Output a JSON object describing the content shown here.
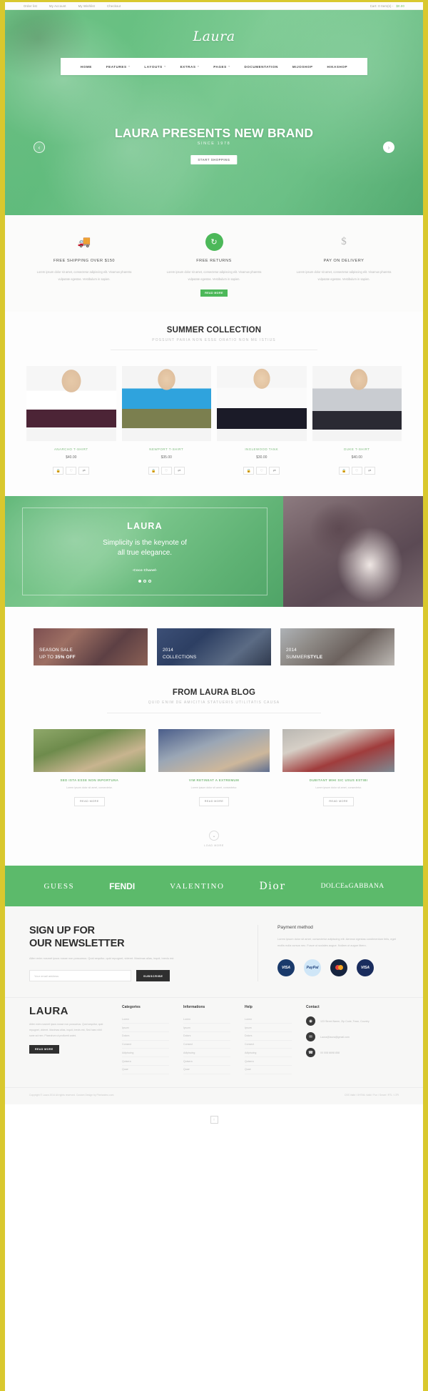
{
  "topbar": {
    "links": [
      "Order list",
      "My Account",
      "My Wishlist",
      "Checkout"
    ],
    "cart_label": "Cart: 0 Item(s) -",
    "cart_total": "$0.00"
  },
  "hero": {
    "brand": "Laura",
    "nav": [
      {
        "label": "HOME",
        "caret": ""
      },
      {
        "label": "FEATURES",
        "caret": "▾"
      },
      {
        "label": "LAYOUTS",
        "caret": "▾"
      },
      {
        "label": "EXTRAS",
        "caret": "▾"
      },
      {
        "label": "PAGES",
        "caret": "▾"
      },
      {
        "label": "DOCUMENTATION",
        "caret": ""
      },
      {
        "label": "MIJOSHOP",
        "caret": ""
      },
      {
        "label": "HIKASHOP",
        "caret": ""
      }
    ],
    "title": "LAURA PRESENTS NEW BRAND",
    "subtitle": "SINCE 1978",
    "button": "START SHOPPING",
    "prev_icon": "‹",
    "next_icon": "›"
  },
  "features": [
    {
      "icon": "truck-icon",
      "glyph": "🚚",
      "title": "FREE SHIPPING OVER $150",
      "body": "Lorem ipsum dolor sit amet, consectetur adipiscing elit. Vivamus pharetra vulputate egestas. Vestibulum in sapien.",
      "button": ""
    },
    {
      "icon": "refresh-icon",
      "glyph": "↻",
      "title": "FREE RETURNS",
      "body": "Lorem ipsum dolor sit amet, consectetur adipiscing elit. Vivamus pharetra vulputate egestas. Vestibulum in sapien.",
      "button": "READ MORE"
    },
    {
      "icon": "dollar-icon",
      "glyph": "$",
      "title": "PAY ON DELIVERY",
      "body": "Lorem ipsum dolor sit amet, consectetur adipiscing elit. Vivamus pharetra vulputate egestas. Vestibulum in sapien.",
      "button": ""
    }
  ],
  "collection": {
    "title": "SUMMER COLLECTION",
    "subtitle": "POSSUNT PARIA NON ESSE ORATIO NON ME ISTIUS",
    "products": [
      {
        "name": "ANARCHO T-SHIRT",
        "price": "$40.00"
      },
      {
        "name": "NEWPORT T-SHIRT",
        "price": "$35.00"
      },
      {
        "name": "INGLEWOOD TANK",
        "price": "$30.00"
      },
      {
        "name": "DUKE T-SHIRT",
        "price": "$40.00"
      }
    ],
    "actions": [
      {
        "name": "add-to-cart-icon",
        "glyph": "🔒"
      },
      {
        "name": "wishlist-icon",
        "glyph": "♡"
      },
      {
        "name": "compare-icon",
        "glyph": "⇄"
      }
    ]
  },
  "quote": {
    "heading": "LAURA",
    "text_line1": "Simplicity is the keynote of",
    "text_line2": "all true elegance.",
    "author": "-Coco Chanel-"
  },
  "promos": [
    {
      "line1": "SEASON SALE",
      "line2": "UP TO ",
      "line2_bold": "35% OFF"
    },
    {
      "line1": "2014",
      "line2": "COLLECTIONS",
      "line2_bold": ""
    },
    {
      "line1": "2014",
      "line2": "SUMMER",
      "line2_bold": "STYLE"
    }
  ],
  "blog": {
    "title": "FROM LAURA BLOG",
    "subtitle": "QUID ENIM DE AMICITIA STATUERIS UTILITATIS CAUSA",
    "posts": [
      {
        "title": "SED ISTA ESSE NON INPORTUNA",
        "body": "Lorem ipsum dolor sit amet, consectetur.",
        "button": "READ MORE"
      },
      {
        "title": "VIM RETINEAT A EXTREMUM",
        "body": "Lorem ipsum dolor sit amet, consectetur.",
        "button": "READ MORE"
      },
      {
        "title": "DUBITANT MIHI SIC USUS ESTIBI",
        "body": "Lorem ipsum dolor sit amet, consectetur.",
        "button": "READ MORE"
      }
    ],
    "load_more": "LOAD MORE",
    "load_more_icon": "⌄"
  },
  "brands": [
    "GUESS",
    "FENDI",
    "VALENTINO",
    "Dior",
    "DOLCE"
  ],
  "brand_dg": {
    "main": "DOLCE",
    "amp": "&",
    "second": "GABBANA"
  },
  "newsletter": {
    "heading_l1": "SIGN UP FOR",
    "heading_l2": "OUR NEWSLETTER",
    "body": "Aliter enim nosmet ipsos nosse non possumus. Quid sequitur, quid repugnet, videret. Maximas alias, inquit, brevis est.",
    "placeholder": "Your email address",
    "button": "SUBSCRIBE"
  },
  "payment": {
    "title": "Payment method",
    "body": "Lorem ipsum dolor sit amet, consectetur adipiscing elit. Aenean egestas condimentum felis, eget mollis nulla cursus nec. Fusce ut sodales augue. Nullam ut augue libero.",
    "methods": [
      {
        "name": "visa-icon",
        "label": "VISA"
      },
      {
        "name": "paypal-icon",
        "label": "PayPal"
      },
      {
        "name": "mastercard-icon",
        "label": ""
      },
      {
        "name": "visa-electron-icon",
        "label": "VISA"
      }
    ]
  },
  "footer": {
    "logo": "LAURA",
    "description": "Aliter enim nosmet ipsos nosse non possumus. Quid sequitur, quid repugnet, videret. Maximas alias, inquit, brevis est, Sed haec nihil sane ad rem. Phaedrum ut proficerit animi.",
    "button": "READ MORE",
    "columns": [
      {
        "title": "Categories",
        "items": [
          "Lorem",
          "Ipsum",
          "Dolors",
          "Consect",
          "Adipiscing",
          "Quisera",
          "Quae"
        ]
      },
      {
        "title": "Informations",
        "items": [
          "Lorem",
          "Ipsum",
          "Dolors",
          "Consect",
          "Adipiscing",
          "Quisera",
          "Quae"
        ]
      },
      {
        "title": "Help",
        "items": [
          "Lorem",
          "Ipsum",
          "Dolors",
          "Consect",
          "Adipiscing",
          "Quisera",
          "Quae"
        ]
      }
    ],
    "contact_title": "Contact",
    "contacts": [
      {
        "icon": "location-icon",
        "glyph": "◉",
        "text": "123 Street Name, Zip Code, Town, Country"
      },
      {
        "icon": "mail-icon",
        "glyph": "✉",
        "text": "Laura@laura@gmail.com"
      },
      {
        "icon": "phone-icon",
        "glyph": "☎",
        "text": "00 008 6698 858"
      }
    ]
  },
  "bottom": {
    "left": "Copyright © Laura 2014 All rights reserved. Custom Design by Pixelanimo.com",
    "right_l1": "CSS Valid / XHTML Valid / Fun / Smart / RTL / LTR",
    "right_l2": ""
  },
  "to_top_icon": "↑"
}
